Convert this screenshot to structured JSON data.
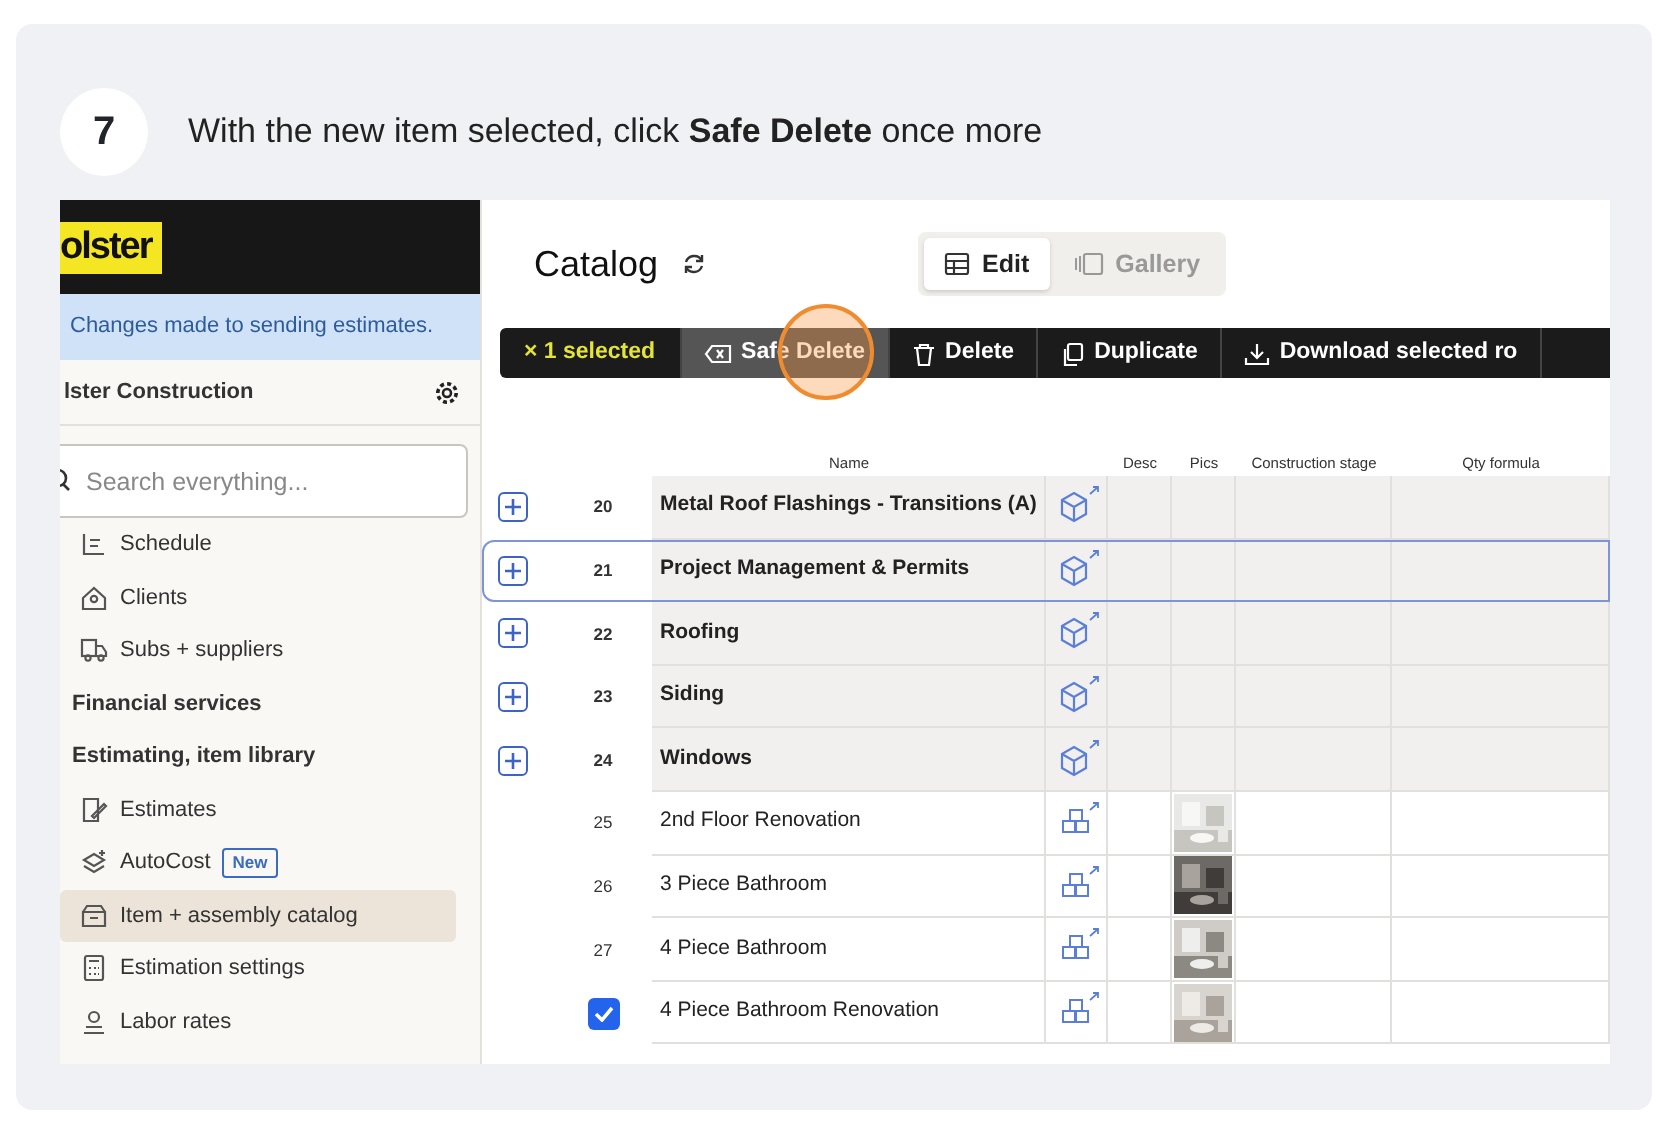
{
  "step": {
    "number": "7",
    "text": "With the new item selected, click **Safe Delete** once more"
  },
  "sidebar": {
    "logo": "olster",
    "banner": "Changes made to sending estimates.",
    "company": "lster Construction",
    "search": {
      "placeholder": "Search everything..."
    },
    "items": [
      {
        "kind": "link",
        "label": "Schedule",
        "selected": false
      },
      {
        "kind": "link",
        "label": "Clients",
        "selected": false
      },
      {
        "kind": "link",
        "label": "Subs + suppliers",
        "selected": false
      },
      {
        "kind": "section",
        "label": "Financial services",
        "selected": false
      },
      {
        "kind": "section",
        "label": "Estimating, item library",
        "selected": false
      },
      {
        "kind": "link",
        "label": "Estimates",
        "selected": false
      },
      {
        "kind": "link",
        "label": "AutoCost",
        "badge": "New",
        "selected": false
      },
      {
        "kind": "link",
        "label": "Item + assembly catalog",
        "selected": true
      },
      {
        "kind": "link",
        "label": "Estimation settings",
        "selected": false
      },
      {
        "kind": "link",
        "label": "Labor rates",
        "selected": false
      }
    ]
  },
  "main": {
    "title": "Catalog",
    "views": [
      {
        "label": "Edit",
        "selected": true
      },
      {
        "label": "Gallery",
        "selected": false
      }
    ],
    "selection": "× 1 selected",
    "actions": [
      {
        "label": "Safe Delete",
        "highlighted": true
      },
      {
        "label": "Delete",
        "highlighted": false
      },
      {
        "label": "Duplicate",
        "highlighted": false
      },
      {
        "label": "Download selected ro",
        "highlighted": false
      }
    ],
    "table": {
      "columns": [
        "Name",
        "Desc",
        "Pics",
        "Construction stage",
        "Qty formula"
      ],
      "rows": [
        {
          "kind": "assembly",
          "number": "20",
          "name": "Metal Roof Flashings - Transitions (A)",
          "focused": false
        },
        {
          "kind": "assembly",
          "number": "21",
          "name": "Project Management & Permits",
          "focused": true
        },
        {
          "kind": "assembly",
          "number": "22",
          "name": "Roofing",
          "focused": false
        },
        {
          "kind": "assembly",
          "number": "23",
          "name": "Siding",
          "focused": false
        },
        {
          "kind": "assembly",
          "number": "24",
          "name": "Windows",
          "focused": false
        },
        {
          "kind": "item",
          "number": "25",
          "name": "2nd Floor Renovation",
          "checked": false,
          "focused": false
        },
        {
          "kind": "item",
          "number": "26",
          "name": "3 Piece Bathroom",
          "checked": false,
          "focused": false
        },
        {
          "kind": "item",
          "number": "27",
          "name": "4 Piece Bathroom",
          "checked": false,
          "focused": false
        },
        {
          "kind": "item",
          "name": "4 Piece Bathroom Renovation",
          "checked": true,
          "focused": false
        }
      ]
    }
  }
}
